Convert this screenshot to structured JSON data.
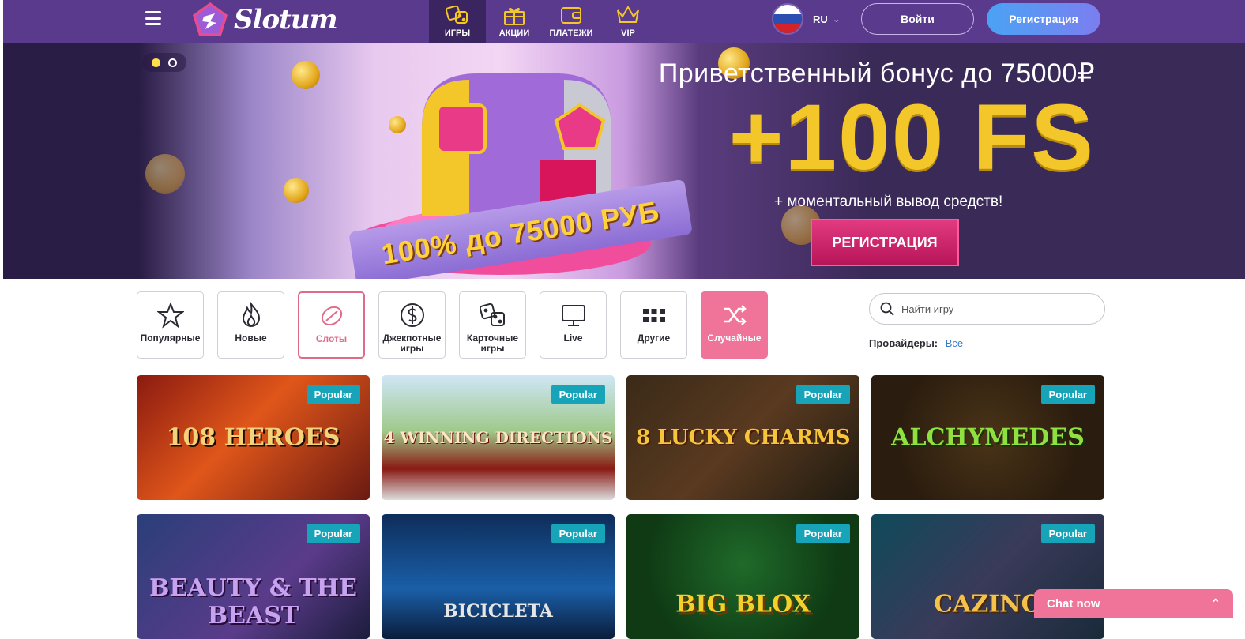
{
  "header": {
    "logo_text": "Slotum",
    "nav": [
      {
        "label": "ИГРЫ",
        "icon": "dice-icon",
        "active": true
      },
      {
        "label": "АКЦИИ",
        "icon": "gift-icon",
        "active": false
      },
      {
        "label": "ПЛАТЕЖИ",
        "icon": "wallet-icon",
        "active": false
      },
      {
        "label": "VIP",
        "icon": "crown-icon",
        "active": false
      }
    ],
    "language": "RU",
    "login_label": "Войти",
    "register_label": "Регистрация"
  },
  "banner": {
    "slide_count": 2,
    "active_slide": 1,
    "title": "Приветственный бонус до 75000₽",
    "headline": "+100 FS",
    "subtitle": "+ моментальный вывод средств!",
    "cta_label": "РЕГИСТРАЦИЯ",
    "ribbon_text": "100% до 75000 РУБ"
  },
  "categories": [
    {
      "label": "Популярные",
      "icon": "star-icon"
    },
    {
      "label": "Новые",
      "icon": "fire-icon"
    },
    {
      "label": "Слоты",
      "icon": "lemon-icon",
      "selected": true
    },
    {
      "label": "Джекпотные игры",
      "icon": "dollar-icon"
    },
    {
      "label": "Карточные игры",
      "icon": "dice-icon"
    },
    {
      "label": "Live",
      "icon": "monitor-icon"
    },
    {
      "label": "Другие",
      "icon": "grid-icon"
    },
    {
      "label": "Случайные",
      "icon": "shuffle-icon",
      "highlight": true
    }
  ],
  "search": {
    "placeholder": "Найти игру"
  },
  "providers": {
    "label": "Провайдеры:",
    "value": "Все"
  },
  "games": [
    {
      "title": "108 HEROES",
      "badge": "Popular"
    },
    {
      "title": "4 WINNING DIRECTIONS",
      "badge": "Popular"
    },
    {
      "title": "8 LUCKY CHARMS",
      "badge": "Popular"
    },
    {
      "title": "ALCHYMEDES",
      "badge": "Popular"
    },
    {
      "title": "BEAUTY & THE BEAST",
      "badge": "Popular"
    },
    {
      "title": "BICICLETA",
      "badge": "Popular"
    },
    {
      "title": "BIG BLOX",
      "badge": "Popular"
    },
    {
      "title": "CAZINO",
      "badge": "Popular"
    }
  ],
  "chat": {
    "label": "Chat now"
  },
  "colors": {
    "header_bg": "#5a3a8c",
    "accent_pink": "#f0739a",
    "badge": "#17a3b8",
    "register_btn": "#4aa3f5"
  }
}
